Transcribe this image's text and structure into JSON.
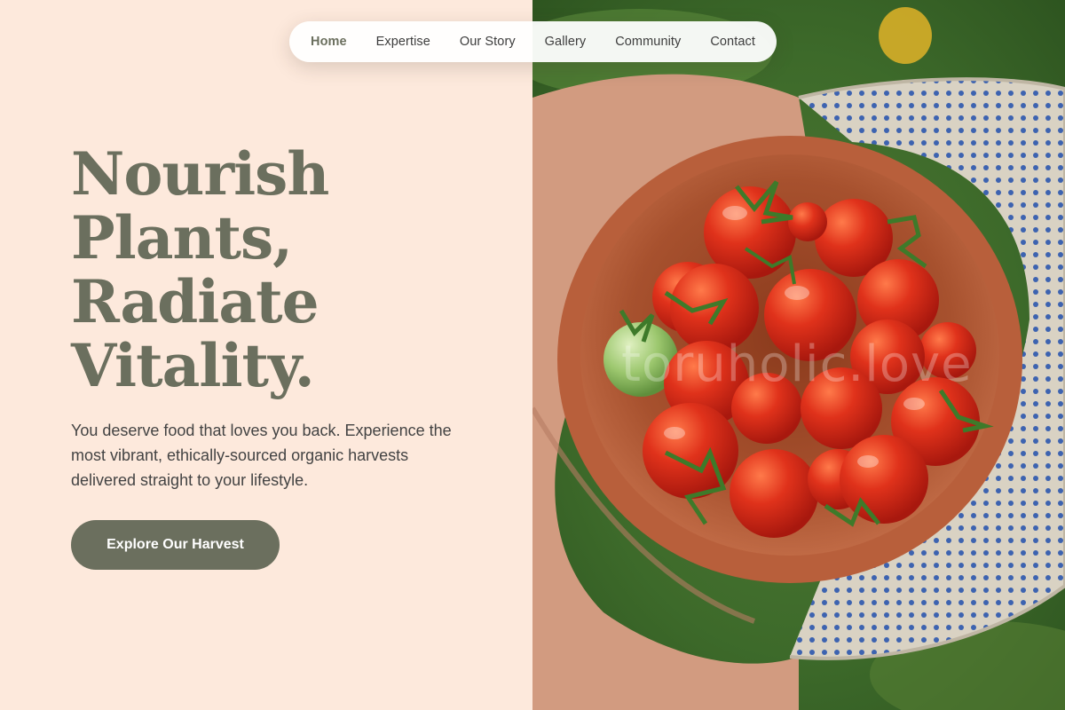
{
  "nav": {
    "items": [
      {
        "label": "Home",
        "active": true
      },
      {
        "label": "Expertise"
      },
      {
        "label": "Our Story"
      },
      {
        "label": "Gallery"
      },
      {
        "label": "Community"
      },
      {
        "label": "Contact"
      }
    ]
  },
  "hero": {
    "title_lines": [
      "Nourish",
      "Plants,",
      "Radiate",
      "Vitality."
    ],
    "description": "You deserve food that loves you back. Experience the most vibrant, ethically-sourced organic harvests delivered straight to your lifestyle.",
    "cta_label": "Explore Our Harvest"
  },
  "image": {
    "subject": "hands holding a clay bowl of cherry tomatoes",
    "watermark": "toruholic.love"
  },
  "colors": {
    "background": "#fde9dc",
    "accent": "#6b6f5e",
    "text": "#434343"
  }
}
